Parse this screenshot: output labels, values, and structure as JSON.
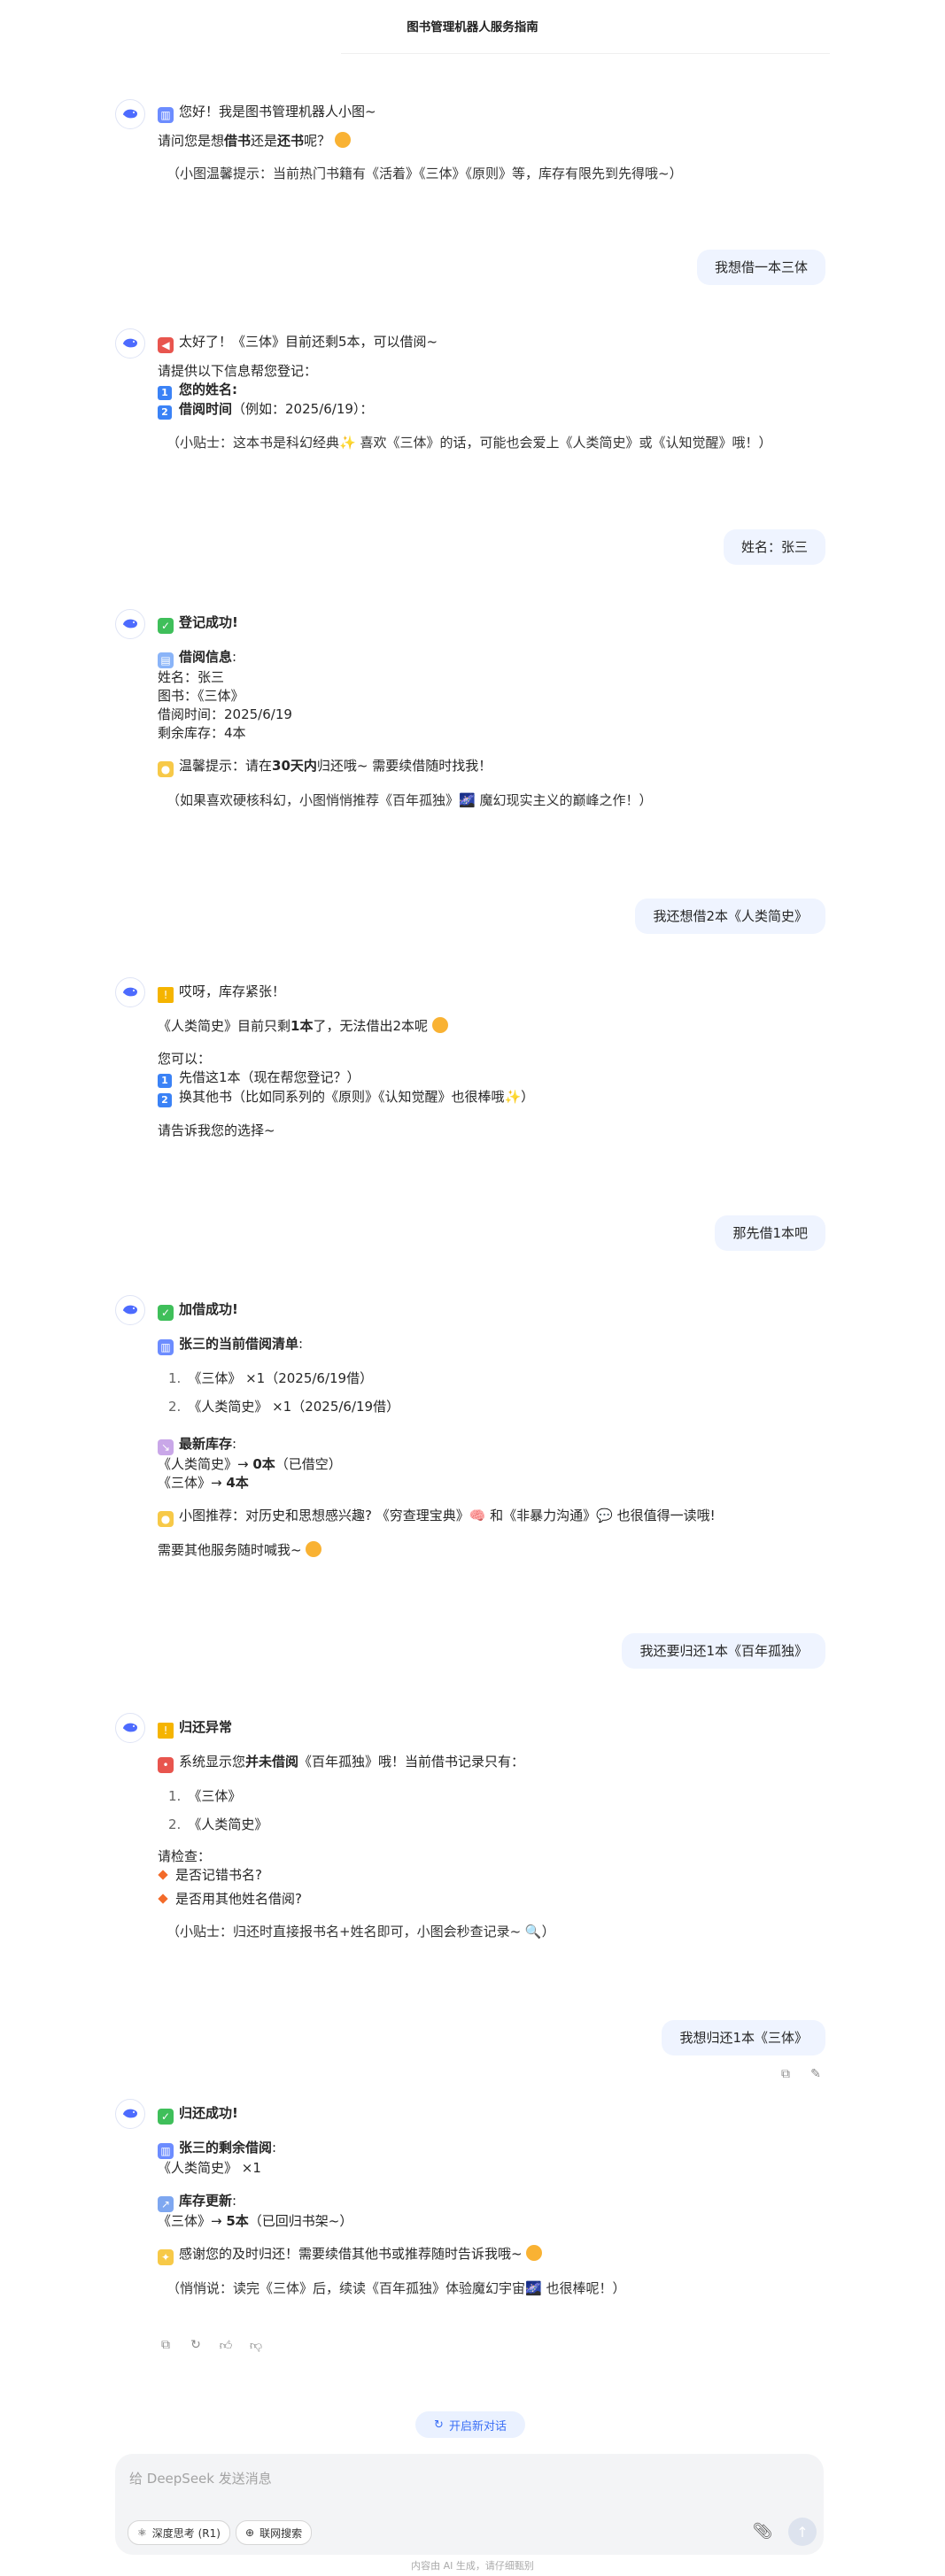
{
  "header": {
    "title": "图书管理机器人服务指南"
  },
  "messages": {
    "m1": {
      "l1": "您好！我是图书管理机器人小图~",
      "l2a": "请问您是想",
      "l2b": "借书",
      "l2c": "还是",
      "l2d": "还书",
      "l2e": "呢？",
      "l3": "（小图温馨提示：当前热门书籍有《活着》《三体》《原则》等，库存有限先到先得哦~）"
    },
    "u1": "我想借一本三体",
    "m2": {
      "l1": "太好了！《三体》目前还剩5本，可以借阅~",
      "l2": "请提供以下信息帮您登记：",
      "l3": "您的姓名",
      "l4a": "借阅时间",
      "l4b": "（例如：2025/6/19）：",
      "l5": "（小贴士：这本书是科幻经典✨ 喜欢《三体》的话，可能也会爱上《人类简史》或《认知觉醒》哦！）"
    },
    "u2": "姓名：张三",
    "m3": {
      "l1": "登记成功!",
      "l2": "借阅信息",
      "l3": "姓名：张三",
      "l4": "图书：《三体》",
      "l5": "借阅时间：2025/6/19",
      "l6": "剩余库存：4本",
      "l7a": "温馨提示：请在",
      "l7b": "30天内",
      "l7c": "归还哦~ 需要续借随时找我！",
      "l8": "（如果喜欢硬核科幻，小图悄悄推荐《百年孤独》🌌 魔幻现实主义的巅峰之作！）"
    },
    "u3": "我还想借2本《人类简史》",
    "m4": {
      "l1": "哎呀，库存紧张！",
      "l2a": "《人类简史》目前只剩",
      "l2b": "1本",
      "l2c": "了，无法借出2本呢",
      "l3": "您可以：",
      "l4": "先借这1本（现在帮您登记？）",
      "l5": "换其他书（比如同系列的《原则》《认知觉醒》也很棒哦✨）",
      "l6": "请告诉我您的选择~"
    },
    "u4": "那先借1本吧",
    "m5": {
      "l1": "加借成功!",
      "l2": "张三的当前借阅清单",
      "l3": "《三体》 ×1（2025/6/19借）",
      "l4": "《人类简史》 ×1（2025/6/19借）",
      "l5": "最新库存",
      "l6a": "《人类简史》→",
      "l6b": "0本",
      "l6c": "（已借空）",
      "l7a": "《三体》→",
      "l7b": "4本",
      "l8": "小图推荐：对历史和思想感兴趣? 《穷查理宝典》🧠 和《非暴力沟通》💬 也很值得一读哦!",
      "l9": "需要其他服务随时喊我~"
    },
    "u5": "我还要归还1本《百年孤独》",
    "m6": {
      "l1": "归还异常",
      "l2a": "系统显示您",
      "l2b": "并未借阅",
      "l2c": "《百年孤独》哦！当前借书记录只有：",
      "l3": "《三体》",
      "l4": "《人类简史》",
      "l5": "请检查：",
      "l6": "是否记错书名?",
      "l7": "是否用其他姓名借阅?",
      "l8": "（小贴士：归还时直接报书名+姓名即可，小图会秒查记录~ 🔍）"
    },
    "u6": "我想归还1本《三体》",
    "m7": {
      "l1": "归还成功!",
      "l2": "张三的剩余借阅",
      "l3": "《人类简史》 ×1",
      "l4": "库存更新",
      "l5a": "《三体》→",
      "l5b": "5本",
      "l5c": "（已回归书架~）",
      "l6": "感谢您的及时归还！需要续借其他书或推荐随时告诉我哦~",
      "l7": "（悄悄说：读完《三体》后，续读《百年孤独》体验魔幻宇宙🌌 也很棒呢！）"
    }
  },
  "labels": {
    "colon": ":",
    "num1": "1",
    "num2": "2",
    "ol1": "1.",
    "ol2": "2."
  },
  "new_chat": "开启新对话",
  "composer": {
    "placeholder": "给 DeepSeek 发送消息",
    "deep_think": "深度思考 (R1)",
    "web_search": "联网搜索"
  },
  "footer": "内容由 AI 生成，请仔细甄别",
  "colors": {
    "accent": "#3b6ff5",
    "user_bubble": "#eff4ff",
    "composer_bg": "#f3f4f6"
  },
  "icons": [
    "deepseek-whale-icon",
    "books-icon",
    "megaphone-icon",
    "check-icon",
    "book-icon",
    "bulb-icon",
    "warning-icon",
    "chart-down-icon",
    "pin-icon",
    "chart-up-icon",
    "sparkles-icon",
    "copy-icon",
    "edit-icon",
    "regenerate-icon",
    "thumb-up-icon",
    "thumb-down-icon",
    "atom-icon",
    "globe-icon",
    "paperclip-icon",
    "send-arrow-icon"
  ]
}
